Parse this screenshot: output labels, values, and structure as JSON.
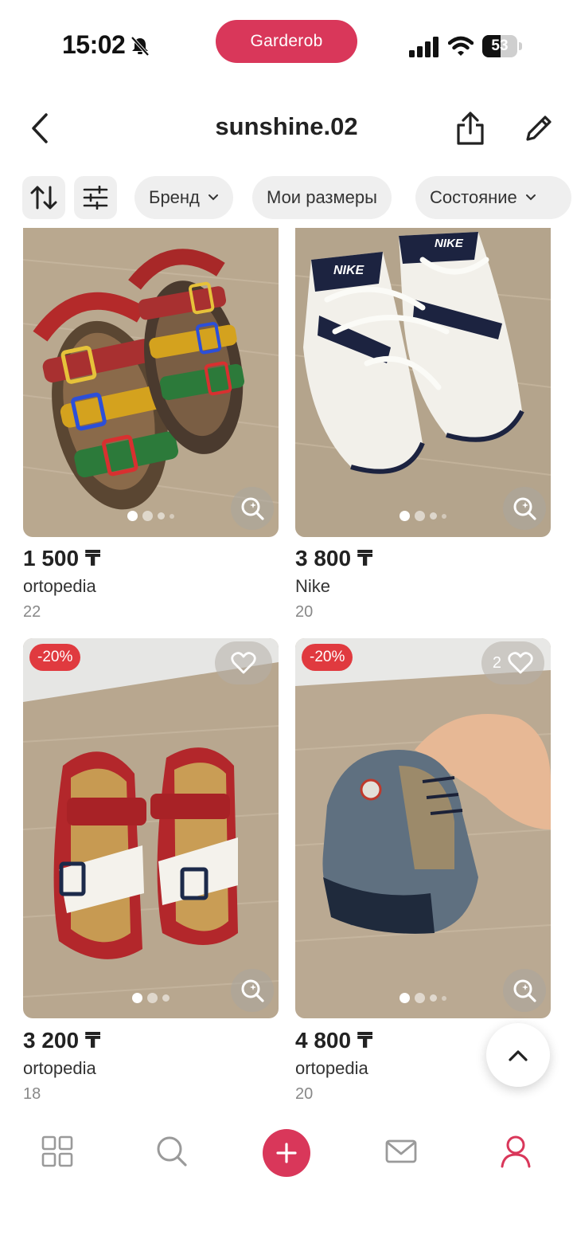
{
  "status_bar": {
    "time": "15:02",
    "app_name": "Garderob",
    "battery": "53",
    "battery_level": 0.53,
    "icons": [
      "bell-slash-icon",
      "signal-icon",
      "wifi-icon",
      "battery-icon"
    ]
  },
  "header": {
    "title": "sunshine.02",
    "icons": [
      "back-chevron-icon",
      "share-icon",
      "edit-pencil-icon"
    ]
  },
  "filters": {
    "icons": [
      "sort-arrows-icon",
      "sliders-icon"
    ],
    "chips": [
      {
        "label": "Бренд",
        "has_chevron": true
      },
      {
        "label": "Мои размеры",
        "has_chevron": false
      },
      {
        "label": "Состояние",
        "has_chevron": true
      }
    ]
  },
  "products": [
    {
      "price": "1 500 ₸",
      "brand": "ortopedia",
      "size": "22",
      "discount": "",
      "likes": "",
      "image": "colorful-sandals-photo",
      "photo_count": 4,
      "current_photo": 1
    },
    {
      "price": "3 800 ₸",
      "brand": "Nike",
      "size": "20",
      "discount": "",
      "likes": "",
      "image": "nike-sneakers-photo",
      "photo_count": 4,
      "current_photo": 1
    },
    {
      "price": "3 200 ₸",
      "brand": "ortopedia",
      "size": "18",
      "discount": "-20%",
      "likes": "",
      "image": "red-white-sandals-photo",
      "photo_count": 3,
      "current_photo": 1
    },
    {
      "price": "4 800 ₸",
      "brand": "ortopedia",
      "size": "20",
      "discount": "-20%",
      "likes": "2",
      "image": "blue-boots-photo",
      "photo_count": 4,
      "current_photo": 1
    }
  ],
  "colors": {
    "accent": "#d9375a",
    "discount": "#e03a3f",
    "chip_bg": "#efefef",
    "floor": "#b7a58d"
  },
  "bottom_nav": {
    "icons": [
      "grid-icon",
      "search-icon",
      "plus-icon",
      "mail-icon",
      "profile-icon"
    ],
    "active": "profile-icon"
  }
}
